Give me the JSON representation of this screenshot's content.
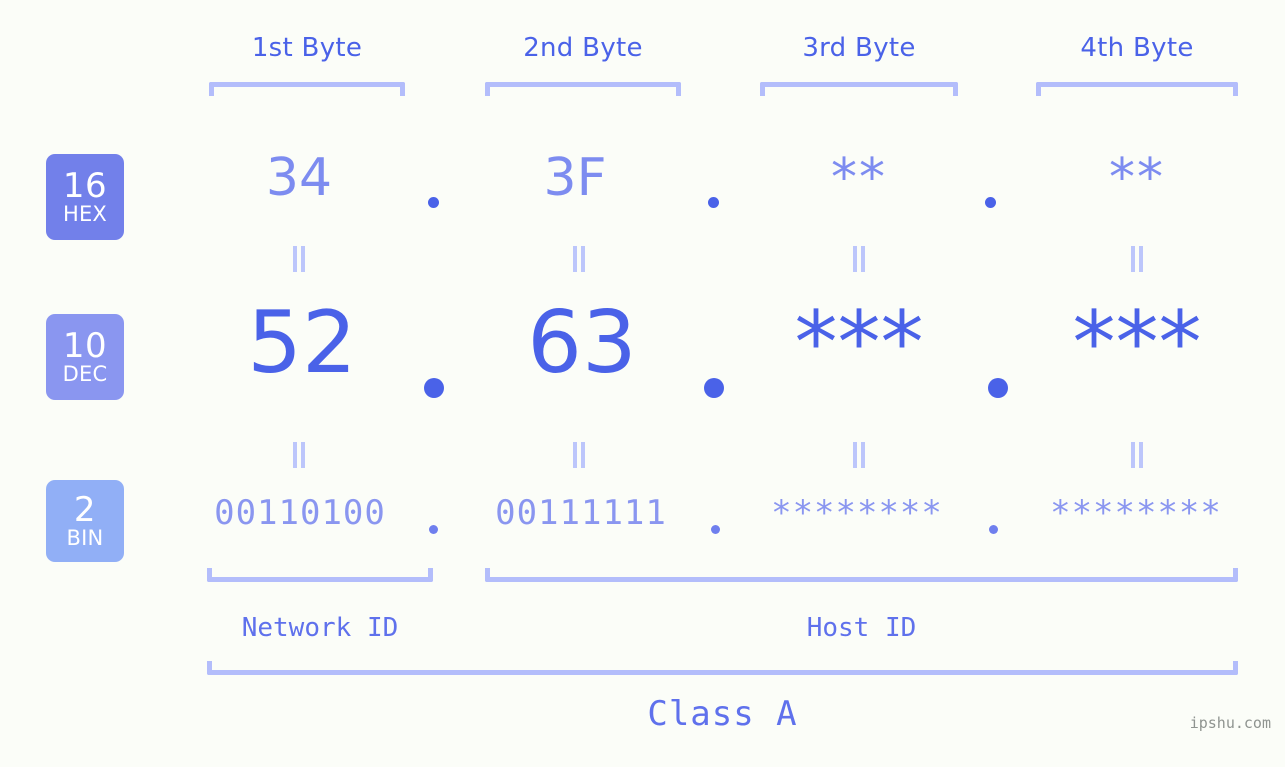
{
  "background_color": "#fbfdf8",
  "accent_color": "#4a62e8",
  "bracket_color": "#b3bdfb",
  "byte_headers": [
    {
      "label": "1st Byte"
    },
    {
      "label": "2nd Byte"
    },
    {
      "label": "3rd Byte"
    },
    {
      "label": "4th Byte"
    }
  ],
  "rows": {
    "hex": {
      "badge_number": "16",
      "badge_label": "HEX",
      "badge_color": "#7280ea",
      "values": [
        "34",
        "3F",
        "**",
        "**"
      ],
      "separator": "."
    },
    "dec": {
      "badge_number": "10",
      "badge_label": "DEC",
      "badge_color": "#8a96f0",
      "values": [
        "52",
        "63",
        "***",
        "***"
      ],
      "separator": "."
    },
    "bin": {
      "badge_number": "2",
      "badge_label": "BIN",
      "badge_color": "#91aff6",
      "values": [
        "00110100",
        "00111111",
        "********",
        "********"
      ],
      "separator": "."
    }
  },
  "equality_marks": {
    "symbol": "=",
    "count_per_row": 4
  },
  "footer": {
    "network_id_label": "Network ID",
    "host_id_label": "Host ID",
    "class_label": "Class A",
    "watermark": "ipshu.com"
  }
}
